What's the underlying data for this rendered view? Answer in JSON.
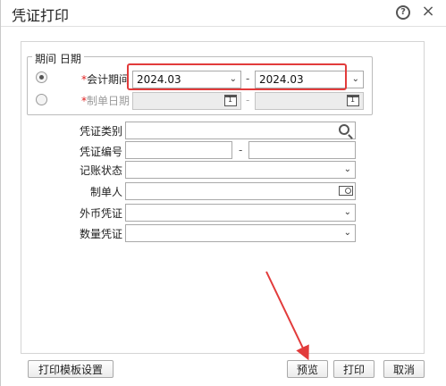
{
  "window": {
    "title": "凭证打印",
    "help_glyph": "?",
    "close_glyph": "×"
  },
  "period_group": {
    "legend": "期间 日期",
    "accounting_period": {
      "required_mark": "*",
      "label": "会计期间",
      "from": "2024.03",
      "dash": "-",
      "to": "2024.03",
      "selected": true
    },
    "voucher_date": {
      "required_mark": "*",
      "label": "制单日期",
      "dash": "-",
      "selected": false
    }
  },
  "fields": {
    "voucher_type": {
      "label": "凭证类别",
      "value": ""
    },
    "voucher_number": {
      "label": "凭证编号",
      "dash": "-",
      "from": "",
      "to": ""
    },
    "posting_status": {
      "label": "记账状态",
      "value": ""
    },
    "preparer": {
      "label": "制单人",
      "value": ""
    },
    "foreign_currency": {
      "label": "外币凭证",
      "value": ""
    },
    "quantity": {
      "label": "数量凭证",
      "value": ""
    }
  },
  "buttons": {
    "template_settings": "打印模板设置",
    "preview": "预览",
    "print": "打印",
    "cancel": "取消"
  },
  "annotation": {
    "highlight_color": "#e23b3b"
  }
}
